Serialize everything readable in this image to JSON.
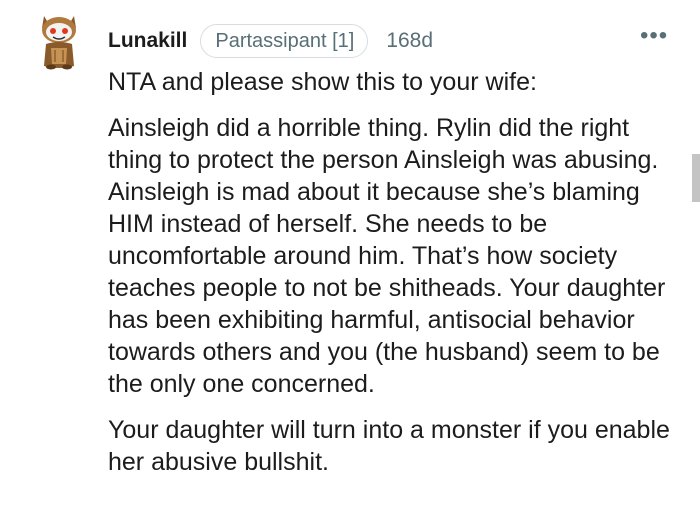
{
  "comment": {
    "author": "Lunakill",
    "flair": "Partassipant [1]",
    "age": "168d",
    "more_label": "•••",
    "paragraphs": [
      "NTA and please show this to your wife:",
      "Ainsleigh did a horrible thing. Rylin did the right thing to protect the person Ainsleigh was abusing. Ainsleigh is mad about it because she’s blaming HIM instead of herself. She needs to be uncomfortable around him. That’s how society teaches people to not be shitheads. Your daughter has been exhibiting harmful, antisocial behavior towards others and you (the husband) seem to be the only one concerned.",
      "Your daughter will turn into a monster if you enable her abusive bullshit."
    ]
  }
}
